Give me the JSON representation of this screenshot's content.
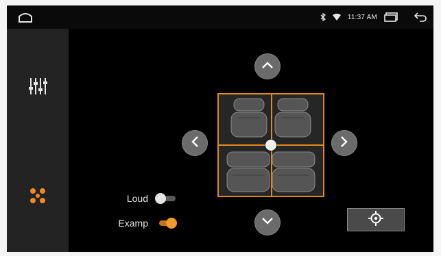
{
  "status_bar": {
    "time": "11:37 AM",
    "icons": [
      "home-icon",
      "bluetooth-icon",
      "wifi-icon",
      "recent-apps-icon",
      "back-icon"
    ]
  },
  "sidebar": {
    "items": [
      {
        "name": "equalizer",
        "icon": "equalizer-sliders-icon",
        "active": false
      },
      {
        "name": "balance",
        "icon": "speaker-balance-icon",
        "active": true
      }
    ]
  },
  "controls": {
    "toggles": [
      {
        "label": "Loud",
        "state": "off"
      },
      {
        "label": "Examp",
        "state": "on"
      }
    ],
    "arrows": [
      "arrow-up-icon",
      "arrow-down-icon",
      "arrow-left-icon",
      "arrow-right-icon"
    ],
    "reset_icon": "crosshair-center-icon"
  },
  "colors": {
    "accent": "#e08a1e",
    "toggle_on": "#f49a2a",
    "background": "#000000",
    "sidebar": "#232323"
  }
}
